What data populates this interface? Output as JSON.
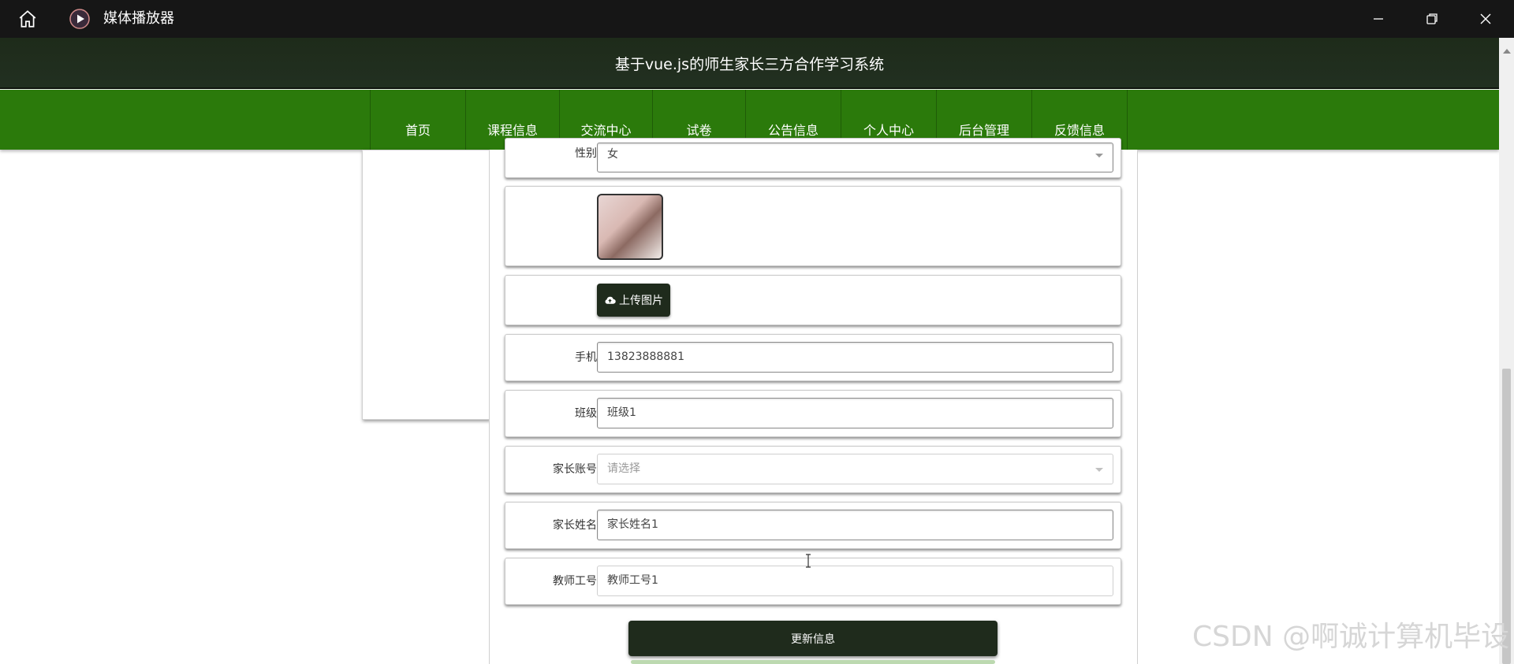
{
  "window": {
    "title": "媒体播放器",
    "icons": [
      "home-icon",
      "media-player-icon",
      "minimize-icon",
      "restore-icon",
      "close-icon"
    ]
  },
  "site": {
    "title": "基于vue.js的师生家长三方合作学习系统"
  },
  "nav": {
    "items": [
      {
        "label": "首页"
      },
      {
        "label": "课程信息"
      },
      {
        "label": "交流中心"
      },
      {
        "label": "试卷"
      },
      {
        "label": "公告信息"
      },
      {
        "label": "个人中心"
      },
      {
        "label": "后台管理"
      },
      {
        "label": "反馈信息"
      }
    ]
  },
  "form": {
    "gender": {
      "label": "性别",
      "value": "女"
    },
    "upload_button": "上传图片",
    "phone": {
      "label": "手机",
      "value": "13823888881"
    },
    "class": {
      "label": "班级",
      "value": "班级1"
    },
    "parent_account": {
      "label": "家长账号",
      "placeholder": "请选择"
    },
    "parent_name": {
      "label": "家长姓名",
      "value": "家长姓名1"
    },
    "teacher_id": {
      "label": "教师工号",
      "value": "教师工号1"
    },
    "submit_button": "更新信息"
  },
  "watermark": "CSDN @啊诚计算机毕设",
  "colors": {
    "titlebar": "#161616",
    "header": "#223021",
    "nav": "#2b7a0b",
    "button": "#1f2b1c"
  }
}
